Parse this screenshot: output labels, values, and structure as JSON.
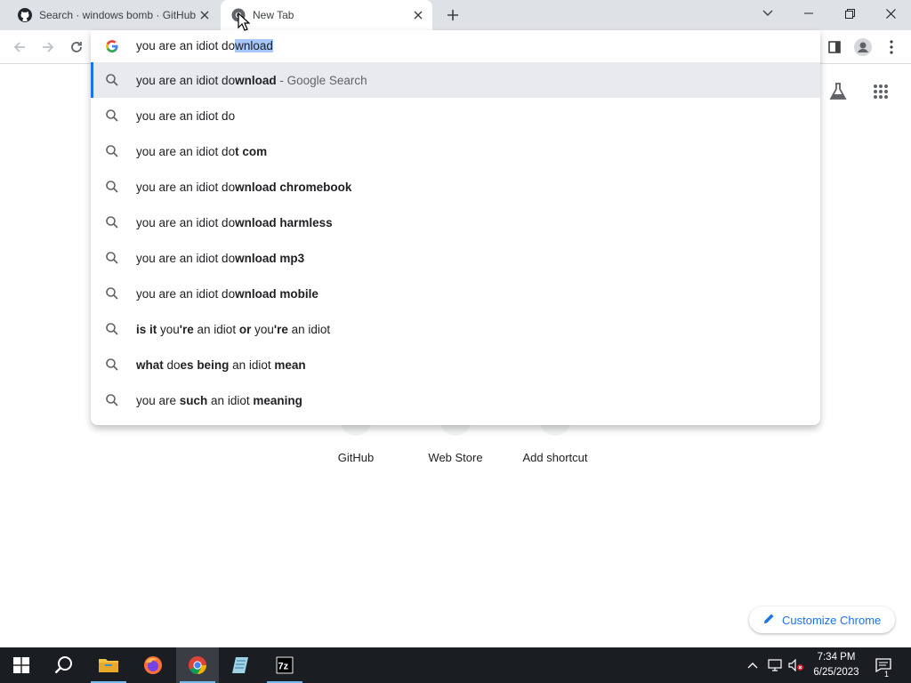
{
  "tabs": [
    {
      "title": "Search · windows bomb · GitHub",
      "active": false
    },
    {
      "title": "New Tab",
      "active": true
    }
  ],
  "omnibox": {
    "typed": "you are an idiot do",
    "autocomplete": "wnload",
    "suggestions": [
      {
        "parts": [
          [
            "you are an idiot do",
            false
          ],
          [
            "wnload",
            true
          ]
        ],
        "suffix": "- Google Search",
        "highlight": true
      },
      {
        "parts": [
          [
            "you are an idiot do",
            false
          ]
        ]
      },
      {
        "parts": [
          [
            "you are an idiot do",
            false
          ],
          [
            "t com",
            true
          ]
        ]
      },
      {
        "parts": [
          [
            "you are an idiot do",
            false
          ],
          [
            "wnload chromebook",
            true
          ]
        ]
      },
      {
        "parts": [
          [
            "you are an idiot do",
            false
          ],
          [
            "wnload harmless",
            true
          ]
        ]
      },
      {
        "parts": [
          [
            "you are an idiot do",
            false
          ],
          [
            "wnload mp3",
            true
          ]
        ]
      },
      {
        "parts": [
          [
            "you are an idiot do",
            false
          ],
          [
            "wnload mobile",
            true
          ]
        ]
      },
      {
        "parts": [
          [
            "is it",
            true
          ],
          [
            " you",
            false
          ],
          [
            "'re",
            true
          ],
          [
            " an idiot ",
            false
          ],
          [
            "or",
            true
          ],
          [
            " you",
            false
          ],
          [
            "'re",
            true
          ],
          [
            " an idiot",
            false
          ]
        ]
      },
      {
        "parts": [
          [
            "what",
            true
          ],
          [
            " do",
            false
          ],
          [
            "es being",
            true
          ],
          [
            " an idiot ",
            false
          ],
          [
            "mean",
            true
          ]
        ]
      },
      {
        "parts": [
          [
            "you are ",
            false
          ],
          [
            "such",
            true
          ],
          [
            " an idiot ",
            false
          ],
          [
            "meaning",
            true
          ]
        ]
      }
    ]
  },
  "shortcuts": [
    {
      "label": "GitHub"
    },
    {
      "label": "Web Store"
    },
    {
      "label": "Add shortcut"
    }
  ],
  "customize_label": "Customize Chrome",
  "taskbar": {
    "time": "7:34 PM",
    "date": "6/25/2023",
    "notification_count": "1",
    "apps": [
      "start-icon",
      "search-icon",
      "file-explorer-icon",
      "firefox-icon",
      "chrome-icon",
      "notepad-icon",
      "7zip-icon"
    ]
  },
  "colors": {
    "tabstrip": "#dee1e6",
    "accent": "#1a73e8",
    "taskbar": "#1a1d22",
    "selection": "#a8c7fa"
  }
}
